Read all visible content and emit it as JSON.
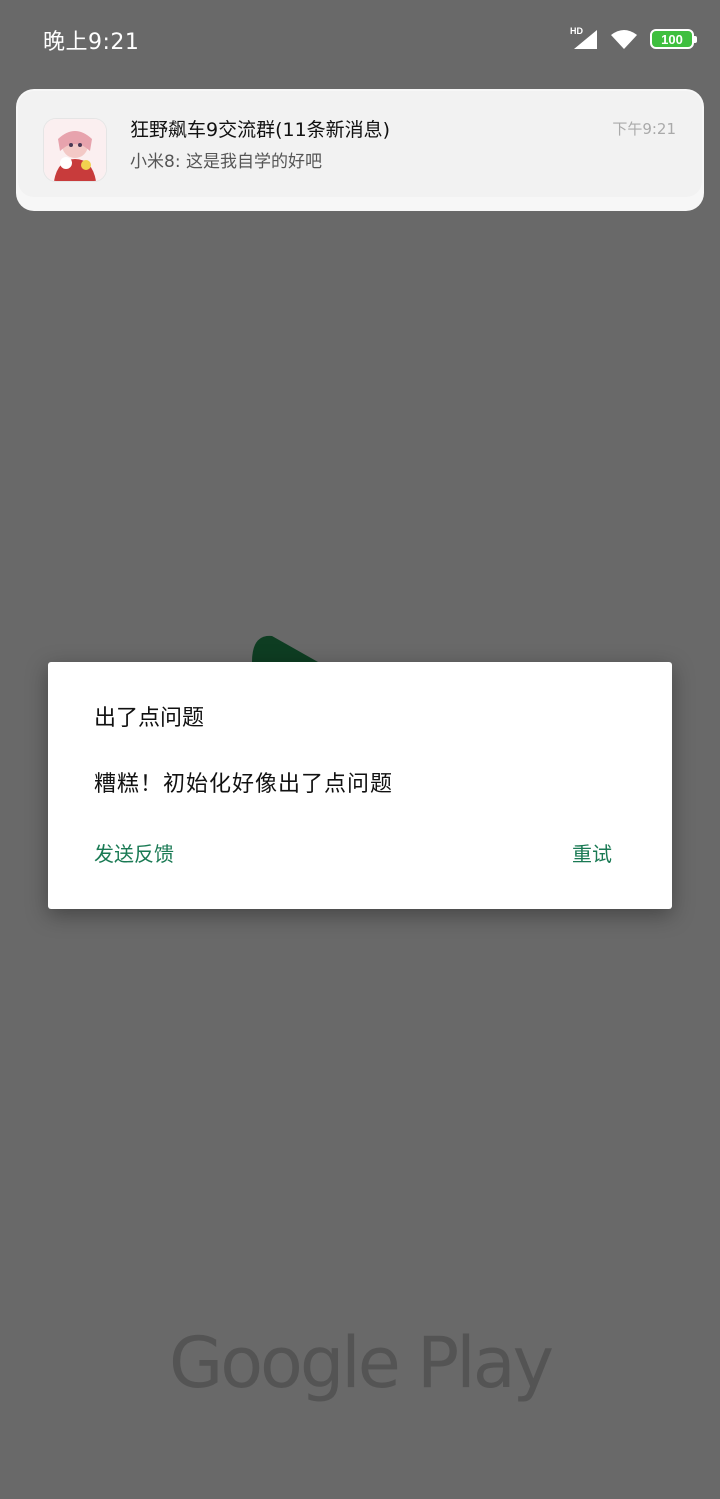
{
  "status_bar": {
    "time": "晚上9:21",
    "network_label": "HD",
    "battery_level": "100",
    "icons": [
      "signal-icon",
      "wifi-icon",
      "battery-icon"
    ],
    "battery_color": "#3fbf3f"
  },
  "notification": {
    "title": "狂野飙车9交流群(11条新消息)",
    "message": "小米8: 这是我自学的好吧",
    "time": "下午9:21",
    "icon": "app-avatar-icon"
  },
  "dialog": {
    "title": "出了点问题",
    "message": "糟糕！初始化好像出了点问题",
    "feedback_button": "发送反馈",
    "retry_button": "重试",
    "accent_color": "#1a7a54"
  },
  "background": {
    "wordmark": "Google Play",
    "color": "#696969"
  }
}
